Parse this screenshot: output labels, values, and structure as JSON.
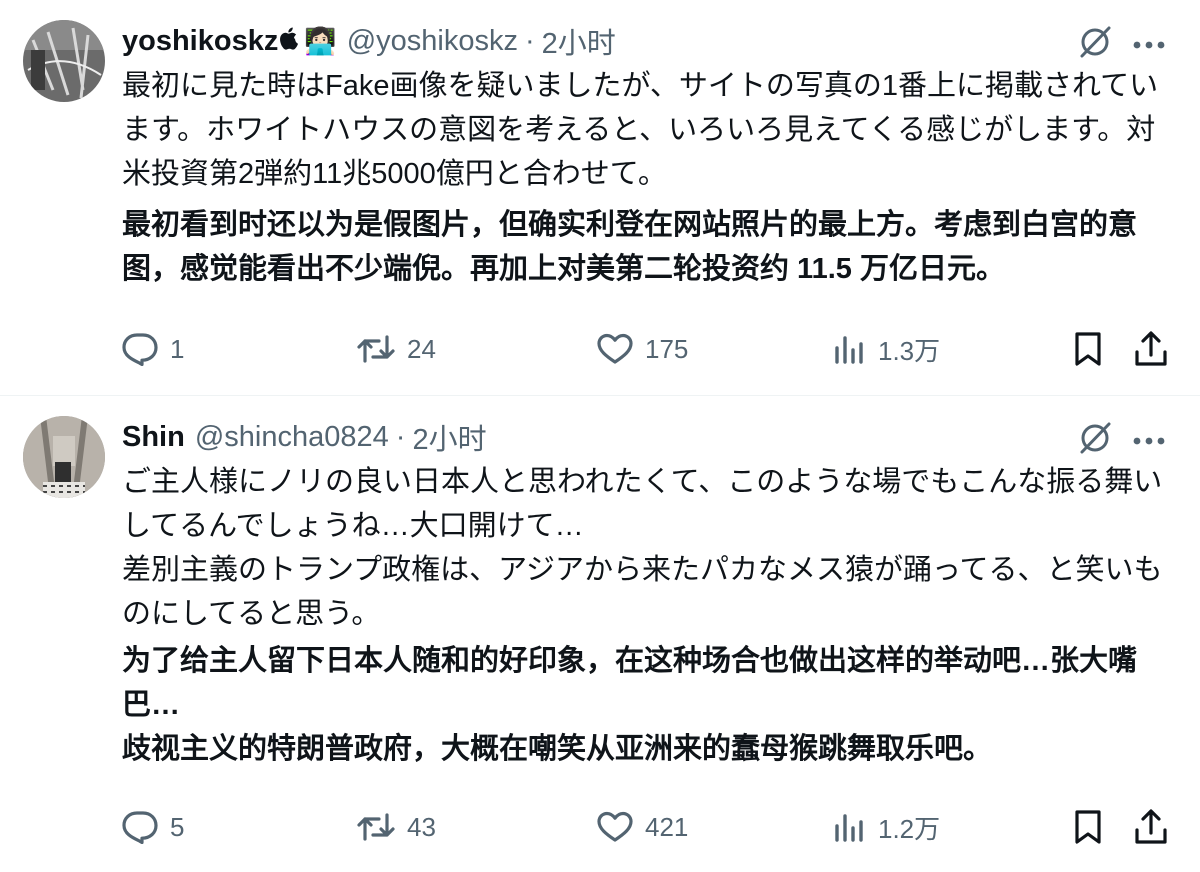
{
  "tweets": [
    {
      "name": "yoshikoskz",
      "name_emoji": "👩🏻‍💻",
      "handle": "@yoshikoskz",
      "sep": "·",
      "time": "2小时",
      "text_jp": [
        "最初に見た時はFake画像を疑いましたが、サイトの写真の1番上に掲載されています。ホワイトハウスの意図を考えると、いろいろ見えてくる感じがします。対米投資第2弾約11兆5000億円と合わせて。"
      ],
      "text_cn": [
        "最初看到时还以为是假图片，但确实利登在网站照片的最上方。考虑到白宫的意图，感觉能看出不少端倪。再加上对美第二轮投资约 11.5 万亿日元。"
      ],
      "stats": {
        "replies": "1",
        "retweets": "24",
        "likes": "175",
        "views": "1.3万"
      }
    },
    {
      "name": "Shin",
      "handle": "@shincha0824",
      "sep": "·",
      "time": "2小时",
      "text_jp": [
        "ご主人様にノリの良い日本人と思われたくて、このような場でもこんな振る舞いしてるんでしょうね…大口開けて…",
        "差別主義のトランプ政権は、アジアから来たパカなメス猿が踊ってる、と笑いものにしてると思う。"
      ],
      "text_cn": [
        "为了给主人留下日本人随和的好印象，在这种场合也做出这样的举动吧…张大嘴巴…",
        "歧视主义的特朗普政府，大概在嘲笑从亚洲来的蠢母猴跳舞取乐吧。"
      ],
      "stats": {
        "replies": "5",
        "retweets": "43",
        "likes": "421",
        "views": "1.2万"
      }
    }
  ],
  "icons": {
    "translate": "grok-translate-icon",
    "more": "more-icon",
    "reply": "reply-icon",
    "retweet": "retweet-icon",
    "like": "like-icon",
    "views": "views-icon",
    "bookmark": "bookmark-icon",
    "share": "share-icon",
    "apple": "apple-icon",
    "laptop": "laptop-icon"
  },
  "colors": {
    "text": "#0f1419",
    "secondary": "#536471",
    "divider": "#eff3f4"
  }
}
